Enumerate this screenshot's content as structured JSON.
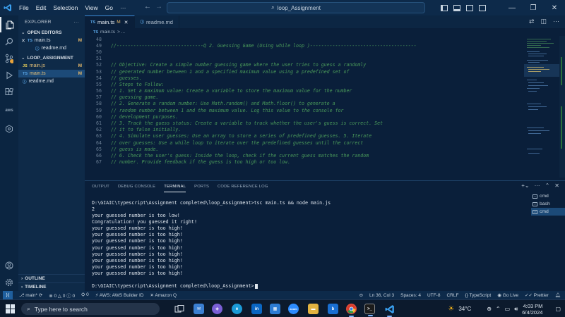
{
  "app": {
    "menu": [
      "File",
      "Edit",
      "Selection",
      "View",
      "Go",
      "···"
    ],
    "search": "loop_Assignment"
  },
  "sidebar": {
    "title": "EXPLORER",
    "open_editors_label": "OPEN EDITORS",
    "open_editors": [
      {
        "icon": "TS",
        "name": "main.ts",
        "badge": "M",
        "closable": true
      },
      {
        "icon": "ⓘ",
        "name": "readme.md",
        "badge": ""
      }
    ],
    "folder_label": "LOOP_ASSIGNMENT",
    "files": [
      {
        "icon": "JS",
        "name": "main.js",
        "badge": "M"
      },
      {
        "icon": "TS",
        "name": "main.ts",
        "badge": "M"
      },
      {
        "icon": "ⓘ",
        "name": "readme.md",
        "badge": ""
      }
    ],
    "outline_label": "OUTLINE",
    "timeline_label": "TIMELINE"
  },
  "editor": {
    "tabs": [
      {
        "icon": "TS",
        "name": "main.ts",
        "badge": "M",
        "active": true
      },
      {
        "icon": "ⓘ",
        "name": "readme.md",
        "badge": "",
        "active": false
      }
    ],
    "breadcrumb": {
      "icon": "TS",
      "file": "main.ts",
      "rest": "> ..."
    },
    "lines": [
      {
        "n": "48",
        "t": ""
      },
      {
        "n": "49",
        "t": "//-------------------------------Q 2. Guessing Game (Using while loop )--------------------------------------"
      },
      {
        "n": "50",
        "t": ""
      },
      {
        "n": "51",
        "t": ""
      },
      {
        "n": "52",
        "t": "// Objective: Create a simple number guessing game where the user tries to guess a randomly"
      },
      {
        "n": "53",
        "t": "// generated number between 1 and a specified maximum value using a predefined set of"
      },
      {
        "n": "54",
        "t": "// guesses."
      },
      {
        "n": "55",
        "t": "// Steps to Follow:"
      },
      {
        "n": "56",
        "t": "// 1. Set a maximum value: Create a variable to store the maximum value for the number"
      },
      {
        "n": "57",
        "t": "// guessing game."
      },
      {
        "n": "58",
        "t": "// 2. Generate a random number: Use Math.random() and Math.floor() to generate a"
      },
      {
        "n": "59",
        "t": "// random number between 1 and the maximum value. Log this value to the console for"
      },
      {
        "n": "60",
        "t": "// development purposes."
      },
      {
        "n": "61",
        "t": "// 3. Track the guess status: Create a variable to track whether the user's guess is correct. Set"
      },
      {
        "n": "62",
        "t": "// it to false initially."
      },
      {
        "n": "63",
        "t": "// 4. Simulate user guesses: Use an array to store a series of predefined guesses. 5. Iterate"
      },
      {
        "n": "64",
        "t": "// over guesses: Use a while loop to iterate over the predefined guesses until the correct"
      },
      {
        "n": "65",
        "t": "// guess is made."
      },
      {
        "n": "66",
        "t": "// 6. Check the user's guess: Inside the loop, check if the current guess matches the random"
      },
      {
        "n": "67",
        "t": "// number. Provide feedback if the guess is too high or too low."
      }
    ]
  },
  "panel": {
    "tabs": [
      "OUTPUT",
      "DEBUG CONSOLE",
      "TERMINAL",
      "PORTS",
      "CODE REFERENCE LOG"
    ],
    "active_tab": "TERMINAL",
    "terminal_lines": [
      "D:\\GIAIC\\typescript\\Assignment completed\\loop_Assignment>tsc main.ts && node main.js",
      "2",
      "your guessed number is too low!",
      "Congratulation! you guessed it right!",
      "your guessed number is too high!",
      "your guessed number is too high!",
      "your guessed number is too high!",
      "your guessed number is too high!",
      "your guessed number is too high!",
      "your guessed number is too high!",
      "your guessed number is too high!",
      "your guessed number is too high!",
      ""
    ],
    "prompt": "D:\\GIAIC\\typescript\\Assignment completed\\loop_Assignment>",
    "terminals": [
      {
        "name": "cmd",
        "active": false
      },
      {
        "name": "bash",
        "active": false
      },
      {
        "name": "cmd",
        "active": true
      }
    ]
  },
  "statusbar": {
    "branch": "main*",
    "errors": "0",
    "warnings": "0",
    "info": "0",
    "ports": "0",
    "aws": "AWS: AWS Builder ID",
    "amazonq": "Amazon Q",
    "position": "Ln 36, Col 3",
    "spaces": "Spaces: 4",
    "encoding": "UTF-8",
    "eol": "CRLF",
    "language": "TypeScript",
    "golive": "Go Live",
    "prettier": "Prettier"
  },
  "taskbar": {
    "search_placeholder": "Type here to search",
    "weather": "34°C",
    "time": "4:03 PM",
    "date": "6/4/2024"
  },
  "colors": {
    "background": "#0a1f3a",
    "comment": "#4a9a5a",
    "accent": "#3d8bd8",
    "modified": "#e6b86a"
  }
}
